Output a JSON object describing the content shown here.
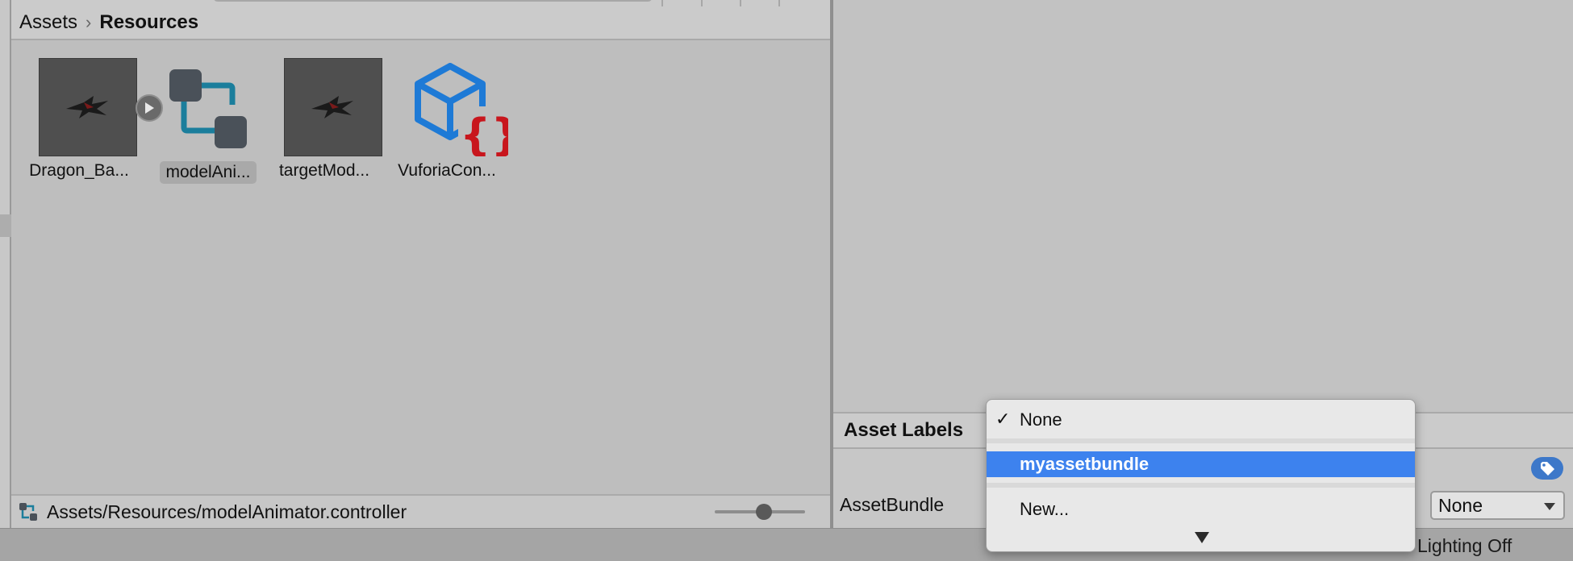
{
  "breadcrumb": {
    "root": "Assets",
    "current": "Resources"
  },
  "assets": [
    {
      "label": "Dragon_Ba...",
      "icon": "dragon-thumbnail-icon",
      "selected": false
    },
    {
      "label": "modelAni...",
      "icon": "animator-controller-icon",
      "selected": true
    },
    {
      "label": "targetMod...",
      "icon": "dragon-thumbnail-icon",
      "selected": false
    },
    {
      "label": "VuforiaCon...",
      "icon": "vuforia-config-icon",
      "selected": false
    }
  ],
  "status_path": "Assets/Resources/modelAnimator.controller",
  "inspector": {
    "labels_header": "Asset Labels",
    "assetbundle_label": "AssetBundle",
    "variant_value": "None"
  },
  "popup_menu": {
    "items": [
      {
        "label": "None",
        "checked": true
      },
      {
        "label": "myassetbundle",
        "highlighted": true
      },
      {
        "label": "New..."
      }
    ]
  },
  "statusbar": {
    "lighting": "Lighting Off"
  },
  "colors": {
    "highlight": "#3d82ee",
    "tag_button": "#3d78c9",
    "vuforia_blue": "#1e7ad6",
    "vuforia_red": "#c8161d",
    "controller_teal": "#1b7e9c"
  }
}
